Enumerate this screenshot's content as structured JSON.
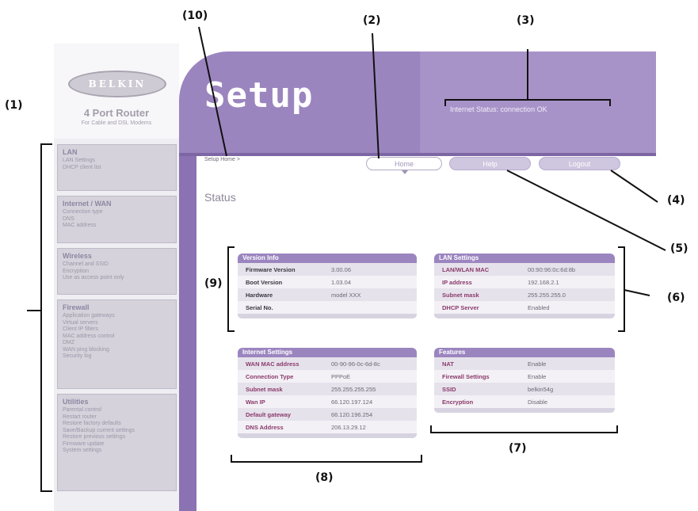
{
  "callouts": {
    "c1": "(1)",
    "c2": "(2)",
    "c3": "(3)",
    "c4": "(4)",
    "c5": "(5)",
    "c6": "(6)",
    "c7": "(7)",
    "c8": "(8)",
    "c9": "(9)",
    "c10": "(10)"
  },
  "brand": {
    "logo_text": "BELKIN",
    "product_name": "4 Port Router",
    "product_sub": "For Cable and DSL Modems"
  },
  "sidebar": {
    "sections": [
      {
        "title": "LAN",
        "items": [
          "LAN Settings",
          "DHCP client list"
        ]
      },
      {
        "title": "Internet / WAN",
        "items": [
          "Connection type",
          "DNS",
          "MAC address"
        ]
      },
      {
        "title": "Wireless",
        "items": [
          "Channel and SSID",
          "Encryption",
          "Use as access point only"
        ]
      },
      {
        "title": "Firewall",
        "items": [
          "Application gateways",
          "Virtual servers",
          "Client IP filters",
          "MAC address control",
          "DMZ",
          "WAN ping blocking",
          "Security log"
        ]
      },
      {
        "title": "Utilities",
        "items": [
          "Parental control",
          "Restart router",
          "Restore factory defaults",
          "Save/Backup current settings",
          "Restore previous settings",
          "Firmware update",
          "System settings"
        ]
      }
    ]
  },
  "header": {
    "title": "Setup",
    "internet_status": "Internet Status: connection OK",
    "menu_label": "Setup Home >"
  },
  "nav": {
    "home": "Home",
    "help": "Help",
    "logout": "Logout"
  },
  "main": {
    "page_title": "Status"
  },
  "panels": {
    "version": {
      "title": "Version Info",
      "rows": [
        {
          "k": "Firmware Version",
          "v": "3.00.06"
        },
        {
          "k": "Boot Version",
          "v": "1.03.04"
        },
        {
          "k": "Hardware",
          "v": "model XXX"
        },
        {
          "k": "Serial No.",
          "v": ""
        }
      ]
    },
    "lan": {
      "title": "LAN Settings",
      "rows": [
        {
          "k": "LAN/WLAN MAC",
          "v": "00:90:96:0c:6d:8b"
        },
        {
          "k": "IP address",
          "v": "192.168.2.1"
        },
        {
          "k": "Subnet mask",
          "v": "255.255.255.0"
        },
        {
          "k": "DHCP Server",
          "v": "Enabled"
        }
      ]
    },
    "internet": {
      "title": "Internet Settings",
      "rows": [
        {
          "k": "WAN MAC address",
          "v": "00-90-96-0c-6d-8c"
        },
        {
          "k": "Connection Type",
          "v": "PPPoE"
        },
        {
          "k": "Subnet mask",
          "v": "255.255.255.255"
        },
        {
          "k": "Wan IP",
          "v": "66.120.197.124"
        },
        {
          "k": "Default gateway",
          "v": "66.120.196.254"
        },
        {
          "k": "DNS Address",
          "v": "206.13.29.12"
        }
      ]
    },
    "features": {
      "title": "Features",
      "rows": [
        {
          "k": "NAT",
          "v": "Enable"
        },
        {
          "k": "Firewall Settings",
          "v": "Enable"
        },
        {
          "k": "SSID",
          "v": "belkin54g"
        },
        {
          "k": "Encryption",
          "v": "Disable"
        }
      ]
    }
  },
  "colors": {
    "brand_purple": "#9b85bf",
    "key_text_purple": "#8b3a6b"
  }
}
